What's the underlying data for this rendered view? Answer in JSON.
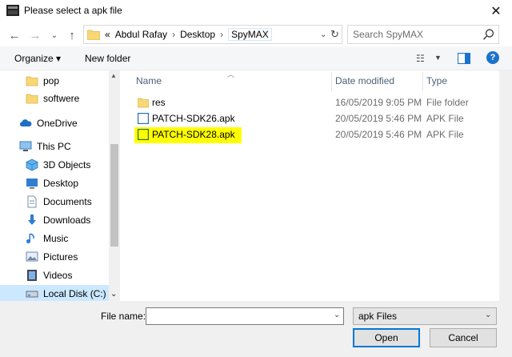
{
  "window": {
    "title": "Please select a apk file",
    "close_glyph": "✕"
  },
  "nav": {
    "back_glyph": "←",
    "forward_glyph": "→",
    "recent_glyph": "⌄",
    "up_glyph": "↑",
    "address": {
      "prefix": "«",
      "segments": [
        "Abdul Rafay",
        "Desktop",
        "SpyMAX"
      ],
      "separator": "›"
    },
    "search_placeholder": "Search SpyMAX"
  },
  "toolbar": {
    "organize_label": "Organize ▾",
    "new_folder_label": "New folder",
    "help_glyph": "?"
  },
  "sidebar": {
    "items": [
      {
        "label": "pop",
        "icon": "folder-icon"
      },
      {
        "label": "softwere",
        "icon": "folder-icon"
      },
      {
        "label": "OneDrive",
        "icon": "cloud-icon"
      },
      {
        "label": "This PC",
        "icon": "computer-icon"
      },
      {
        "label": "3D Objects",
        "icon": "cube-icon"
      },
      {
        "label": "Desktop",
        "icon": "desktop-icon"
      },
      {
        "label": "Documents",
        "icon": "document-icon"
      },
      {
        "label": "Downloads",
        "icon": "download-icon"
      },
      {
        "label": "Music",
        "icon": "music-icon"
      },
      {
        "label": "Pictures",
        "icon": "picture-icon"
      },
      {
        "label": "Videos",
        "icon": "video-icon"
      },
      {
        "label": "Local Disk (C:)",
        "icon": "disk-icon"
      }
    ]
  },
  "filelist": {
    "columns": [
      "Name",
      "Date modified",
      "Type"
    ],
    "rows": [
      {
        "name": "res",
        "date": "16/05/2019 9:05 PM",
        "type": "File folder",
        "icon": "folder-icon"
      },
      {
        "name": "PATCH-SDK26.apk",
        "date": "20/05/2019 5:46 PM",
        "type": "APK File",
        "icon": "file-icon"
      },
      {
        "name": "PATCH-SDK28.apk",
        "date": "20/05/2019 5:46 PM",
        "type": "APK File",
        "icon": "file-icon",
        "highlighted": true
      }
    ]
  },
  "bottom": {
    "filename_label": "File name:",
    "filename_value": "",
    "filetype_value": "apk Files",
    "open_label": "Open",
    "cancel_label": "Cancel"
  },
  "colors": {
    "highlight": "#ffff00",
    "selection": "#cce8ff",
    "accent": "#0078d7"
  }
}
